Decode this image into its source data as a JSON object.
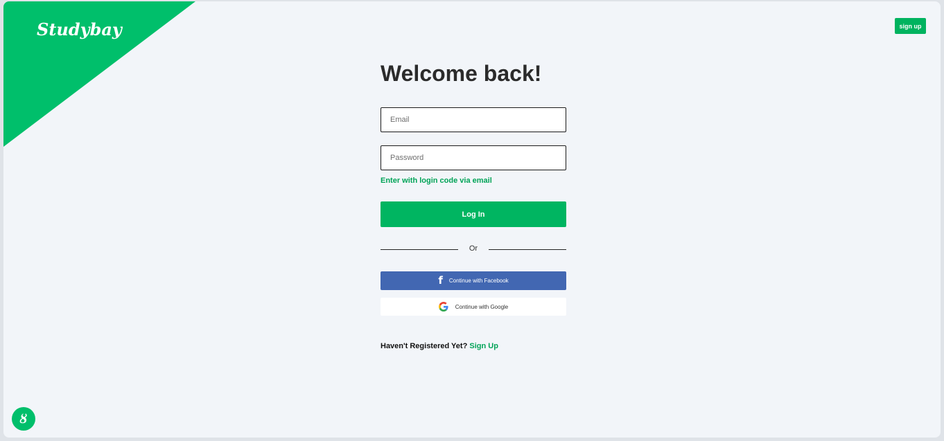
{
  "brand": {
    "logo_text": "Studybay",
    "accent_color": "#00bf6b"
  },
  "header": {
    "signup_label": "sign up"
  },
  "login": {
    "title": "Welcome back!",
    "email_placeholder": "Email",
    "password_placeholder": "Password",
    "code_link": "Enter with login code via email",
    "login_button": "Log In",
    "divider_text": "Or",
    "facebook_button": "Continue with Facebook",
    "facebook_icon": "facebook-icon",
    "google_button": "Continue with Google",
    "google_icon": "google-icon",
    "register_prompt": "Haven't Registered Yet?",
    "register_link": "Sign Up"
  },
  "widget": {
    "chat_icon": "studybay-chat-icon",
    "chat_glyph": "ȣ"
  },
  "colors": {
    "primary_green": "#00b561",
    "link_green": "#00a357",
    "facebook_blue": "#4267b2",
    "background": "#f2f5f9"
  }
}
